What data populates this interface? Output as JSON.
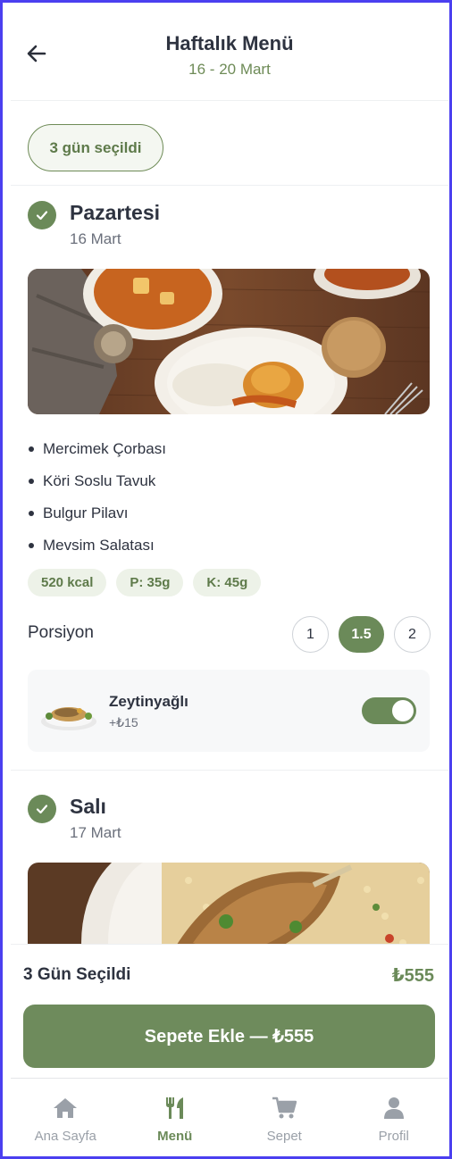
{
  "header": {
    "title": "Haftalık Menü",
    "date_range": "16 - 20 Mart"
  },
  "selection_chip": "3 gün seçildi",
  "days": [
    {
      "name": "Pazartesi",
      "date": "16 Mart",
      "checked": true,
      "items": [
        "Mercimek Çorbası",
        "Köri Soslu Tavuk",
        "Bulgur Pilavı",
        "Mevsim Salatası"
      ],
      "nutrition": [
        "520 kcal",
        "P: 35g",
        "K: 45g"
      ],
      "portion_label": "Porsiyon",
      "portion_options": [
        "1",
        "1.5",
        "2"
      ],
      "portion_selected": "1.5",
      "extra": {
        "name": "Zeytinyağlı",
        "price": "+₺15",
        "enabled": true
      }
    },
    {
      "name": "Salı",
      "date": "17 Mart",
      "checked": true
    }
  ],
  "summary": {
    "label": "3 Gün Seçildi",
    "total": "₺555",
    "cta": "Sepete Ekle — ₺555"
  },
  "tabs": [
    {
      "label": "Ana Sayfa",
      "icon": "home-icon",
      "active": false
    },
    {
      "label": "Menü",
      "icon": "utensils-icon",
      "active": true
    },
    {
      "label": "Sepet",
      "icon": "cart-icon",
      "active": false
    },
    {
      "label": "Profil",
      "icon": "user-icon",
      "active": false
    }
  ],
  "colors": {
    "accent": "#6b8a59",
    "text": "#2e3340",
    "muted": "#9aa0a8"
  }
}
